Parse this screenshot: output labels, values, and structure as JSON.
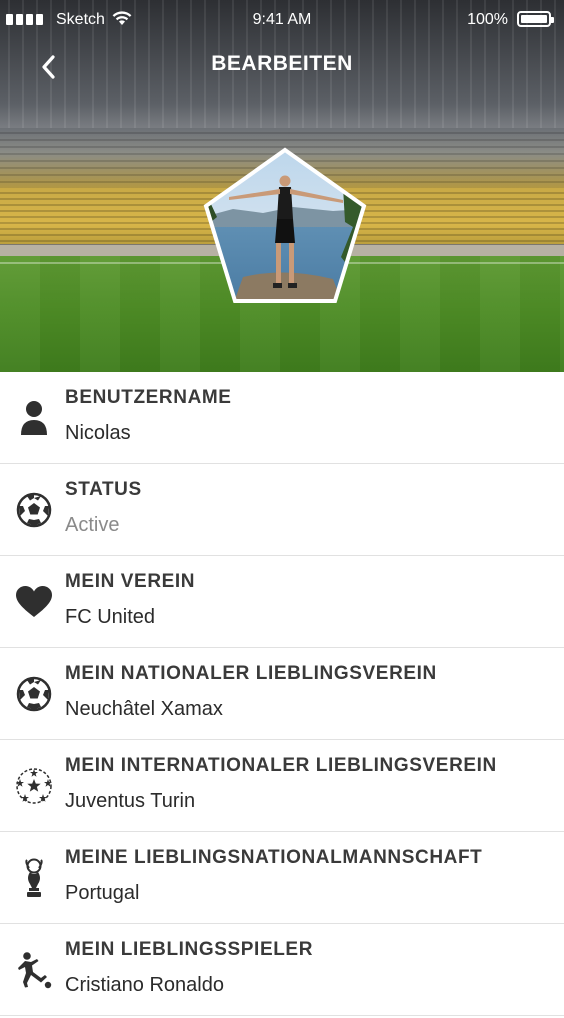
{
  "status_bar": {
    "carrier": "Sketch",
    "time": "9:41 AM",
    "battery": "100%"
  },
  "nav": {
    "title": "BEARBEITEN",
    "back_icon": "chevron-left-icon"
  },
  "fields": [
    {
      "icon": "user-icon",
      "label": "BENUTZERNAME",
      "value": "Nicolas"
    },
    {
      "icon": "soccer-ball-icon",
      "label": "STATUS",
      "value": "Active"
    },
    {
      "icon": "heart-icon",
      "label": "MEIN VEREIN",
      "value": "FC United"
    },
    {
      "icon": "soccer-ball-icon",
      "label": "MEIN NATIONALER LIEBLINGSVEREIN",
      "value": "Neuchâtel Xamax"
    },
    {
      "icon": "champions-ball-icon",
      "label": "MEIN INTERNATIONALER LIEBLINGSVEREIN",
      "value": "Juventus Turin"
    },
    {
      "icon": "world-cup-trophy-icon",
      "label": "MEINE LIEBLINGSNATIONALMANNSCHAFT",
      "value": "Portugal"
    },
    {
      "icon": "kicking-player-icon",
      "label": "MEIN LIEBLINGSSPIELER",
      "value": "Cristiano Ronaldo"
    }
  ],
  "colors": {
    "label": "#3a3a3a",
    "value": "#2b2b2b",
    "muted_value": "#8a8a8a",
    "icon": "#2f2f2f",
    "divider": "#e1e1e1"
  }
}
